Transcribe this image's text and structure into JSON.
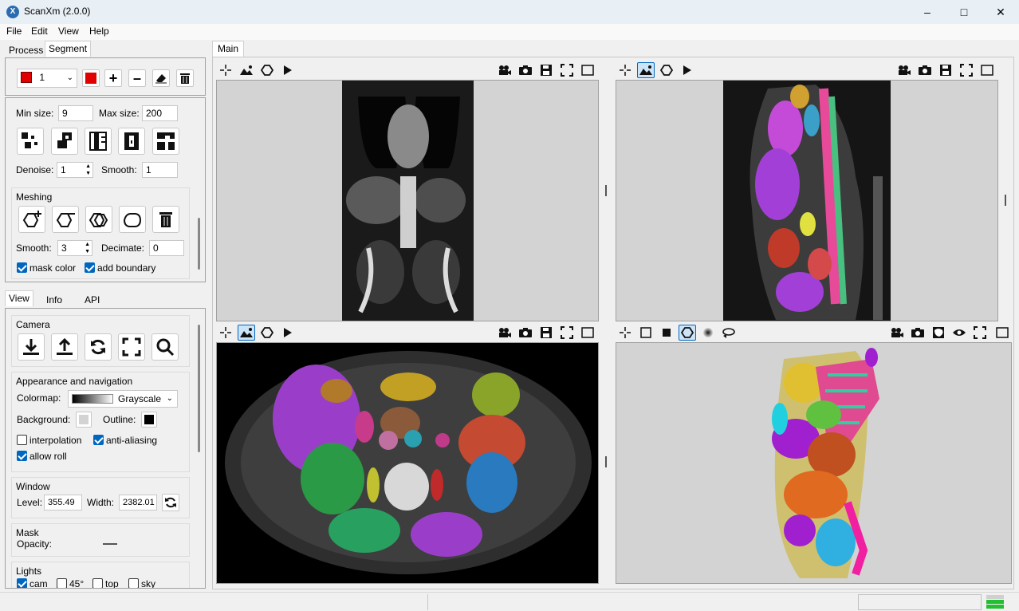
{
  "window": {
    "title": "ScanXm (2.0.0)"
  },
  "menu": [
    "File",
    "Edit",
    "View",
    "Help"
  ],
  "left_tabs": [
    "Process",
    "Segment"
  ],
  "segment": {
    "label_value": "1",
    "label_color": "#e00000",
    "min_size_label": "Min size:",
    "min_size": "9",
    "max_size_label": "Max size:",
    "max_size": "200",
    "denoise_label": "Denoise:",
    "denoise": "1",
    "smooth_label": "Smooth:",
    "smooth": "1",
    "meshing_title": "Meshing",
    "mesh_smooth_label": "Smooth:",
    "mesh_smooth": "3",
    "decimate_label": "Decimate:",
    "decimate": "0",
    "mask_color_label": "mask color",
    "add_boundary_label": "add boundary"
  },
  "bottom_tabs": [
    "View",
    "Info",
    "API"
  ],
  "view": {
    "camera_title": "Camera",
    "appearance_title": "Appearance and navigation",
    "colormap_label": "Colormap:",
    "colormap_value": "Grayscale",
    "background_label": "Background:",
    "outline_label": "Outline:",
    "interpolation_label": "interpolation",
    "antialiasing_label": "anti-aliasing",
    "allow_roll_label": "allow roll",
    "window_title": "Window",
    "level_label": "Level:",
    "level": "355.49",
    "width_label": "Width:",
    "width": "2382.01",
    "mask_title": "Mask",
    "opacity_label": "Opacity:",
    "lights_title": "Lights",
    "light_cam": "cam",
    "light_45": "45°",
    "light_top": "top",
    "light_sky": "sky"
  },
  "main_tab": "Main",
  "colors": {
    "accent": "#0067c0",
    "title_bg": "#e8f0f6"
  }
}
